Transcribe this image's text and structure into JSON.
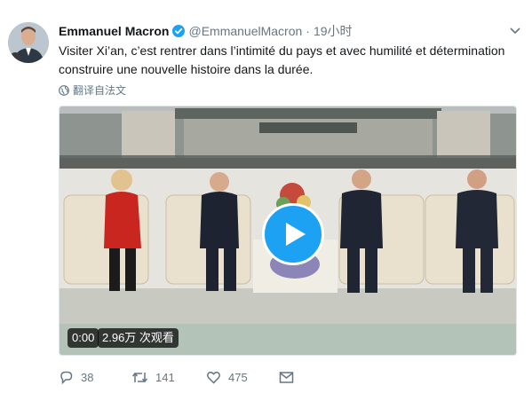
{
  "tweet": {
    "author_name": "Emmanuel Macron",
    "handle": "@EmmanuelMacron",
    "separator": "·",
    "time": "19小时",
    "text": "Visiter Xi’an, c’est rentrer dans l’intimité du pays et avec humilité et détermination construire une nouvelle histoire dans la durée.",
    "translate_label": "翻译自法文"
  },
  "media": {
    "type": "video",
    "elapsed": "0:00",
    "views": "2.96万 次观看"
  },
  "actions": {
    "replies": "38",
    "retweets": "141",
    "likes": "475"
  },
  "colors": {
    "accent": "#1da1f2",
    "text_primary": "#14171a",
    "text_secondary": "#657786"
  },
  "icons": {
    "verified": "verified-badge-icon",
    "caret": "chevron-down-icon",
    "translate": "globe-icon",
    "play": "play-icon",
    "reply": "reply-icon",
    "retweet": "retweet-icon",
    "like": "heart-icon",
    "message": "envelope-icon"
  }
}
